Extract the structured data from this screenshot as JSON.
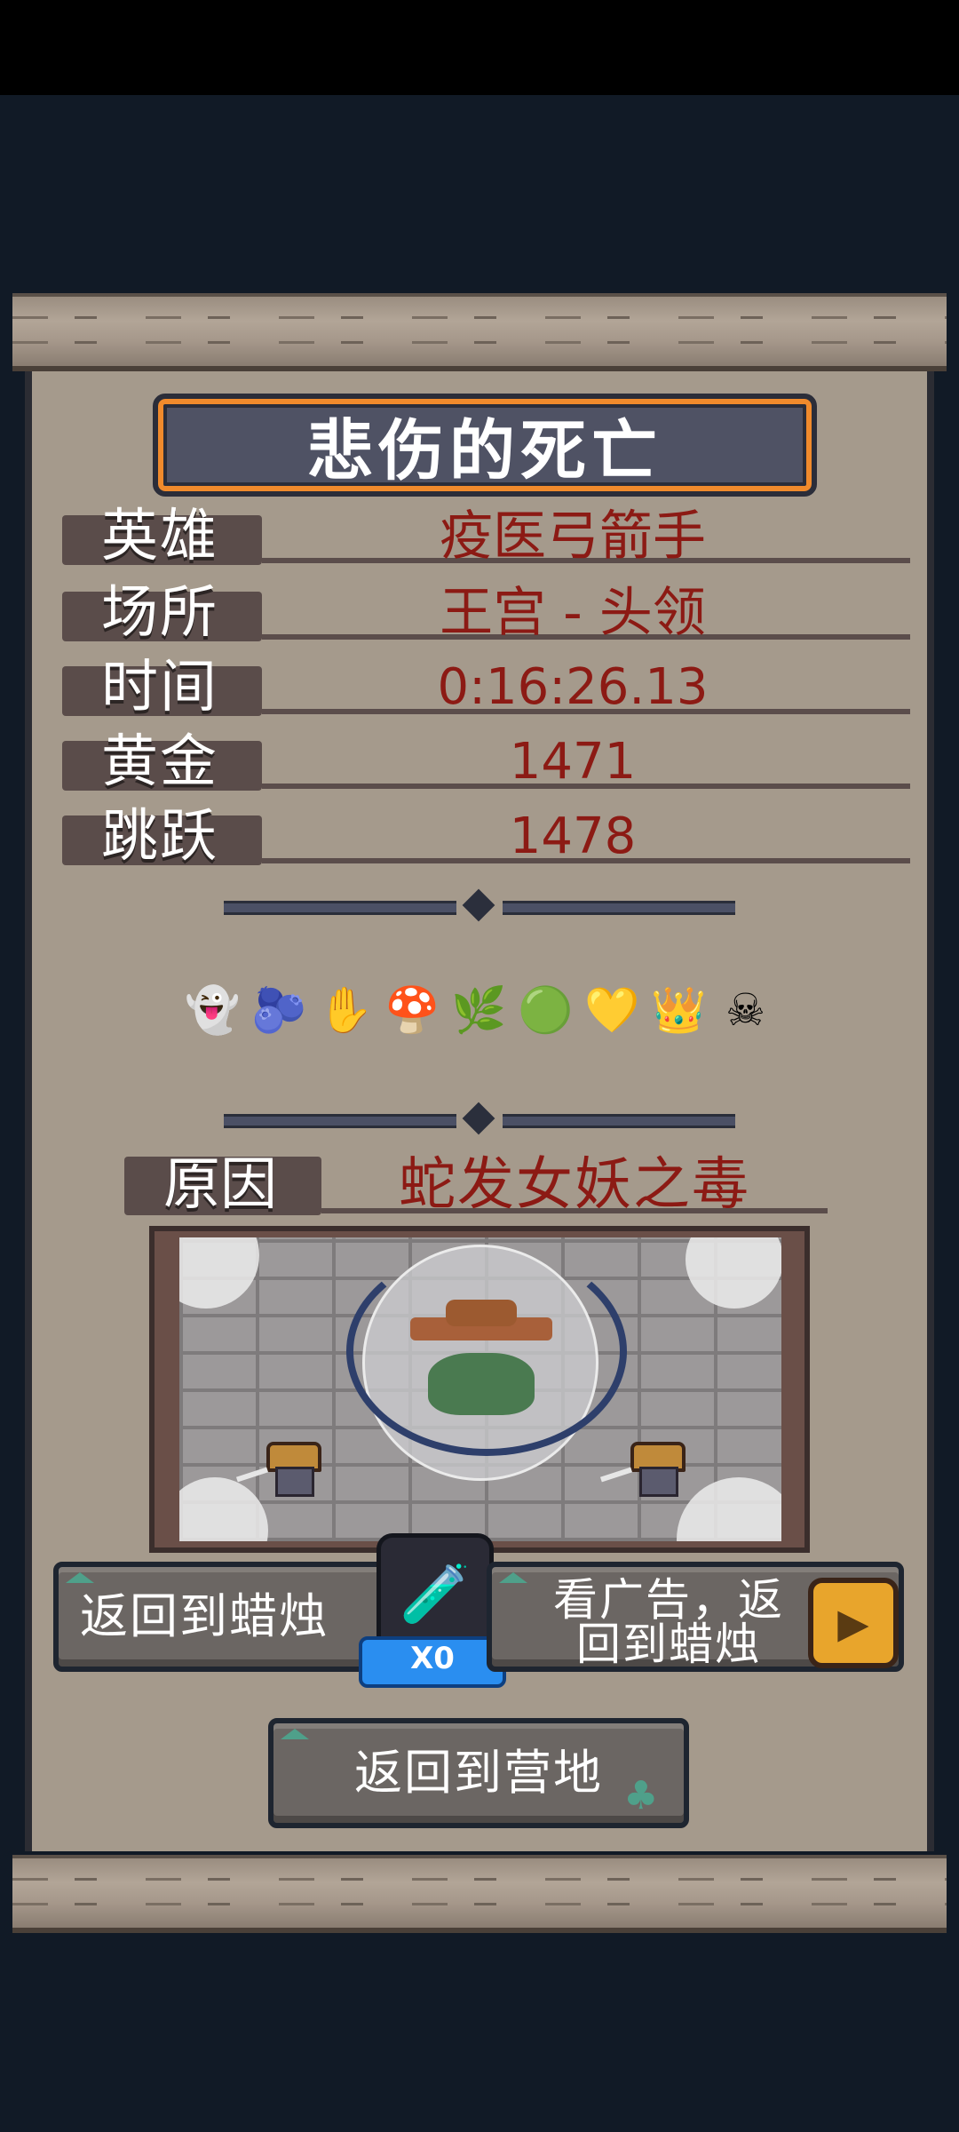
{
  "title": "悲伤的死亡",
  "stats": [
    {
      "label": "英雄",
      "value": "疫医弓箭手"
    },
    {
      "label": "场所",
      "value": "王宫 - 头领"
    },
    {
      "label": "时间",
      "value": "0:16:26.13"
    },
    {
      "label": "黄金",
      "value": "1471"
    },
    {
      "label": "跳跃",
      "value": "1478"
    }
  ],
  "items": [
    {
      "icon": "ghost-hood-icon",
      "glyph": "👻"
    },
    {
      "icon": "berries-icon",
      "glyph": "🫐"
    },
    {
      "icon": "hand-icon",
      "glyph": "✋"
    },
    {
      "icon": "mushroom-icon",
      "glyph": "🍄"
    },
    {
      "icon": "leaf-icon",
      "glyph": "🌿"
    },
    {
      "icon": "green-orb-icon",
      "glyph": "🟢"
    },
    {
      "icon": "gold-heart-icon",
      "glyph": "💛"
    },
    {
      "icon": "crown-icon",
      "glyph": "👑"
    },
    {
      "icon": "skull-crossbones-icon",
      "glyph": "☠"
    }
  ],
  "cause": {
    "label": "原因",
    "value": "蛇发女妖之毒"
  },
  "buttons": {
    "return_candle": "返回到蜡烛",
    "watch_ad_line1": "看广告，返",
    "watch_ad_line2": "回到蜡烛",
    "return_camp": "返回到营地"
  },
  "potion_count": "X0",
  "colors": {
    "background": "#111a26",
    "paper": "#a59a8c",
    "value_text": "#8c1a14",
    "banner": "#4f5264",
    "banner_border": "#f08a2c",
    "badge": "#2a8ef0"
  }
}
